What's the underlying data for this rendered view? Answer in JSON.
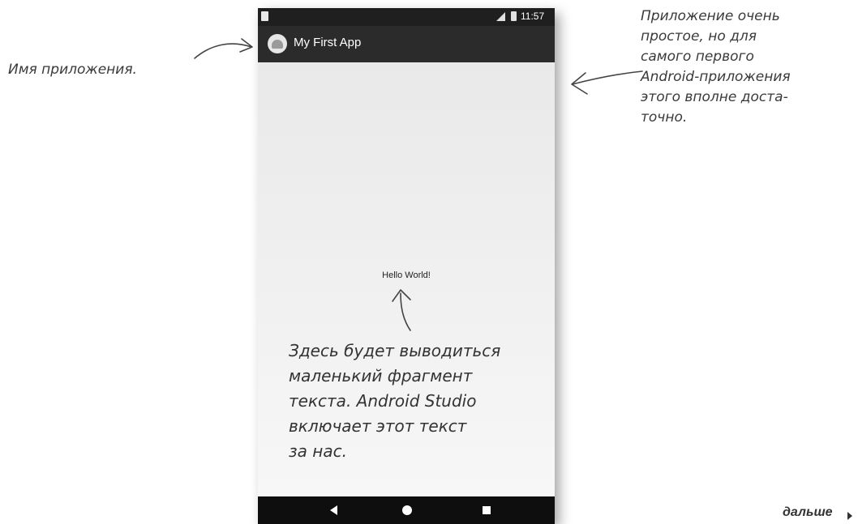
{
  "status_bar": {
    "time": "11:57"
  },
  "app": {
    "title": "My First App"
  },
  "content": {
    "text": "Hello World!"
  },
  "annotations": {
    "app_name": "Имя приложения.",
    "simple_app": "Приложение очень\nпростое, но для\nсамого первого\nAndroid-приложения\nэтого вполне доста-\nточно.",
    "text_fragment": "Здесь будет выводиться\nмаленький фрагмент\nтекста. Android Studio\nвключает этот текст\nза нас."
  },
  "footer": {
    "next_label": "дальше"
  },
  "icons": {
    "sim": "sim-card-icon",
    "signal": "signal-icon",
    "battery": "battery-icon",
    "app": "android-app-icon",
    "back": "back-icon",
    "home": "home-icon",
    "recents": "recents-icon",
    "next": "next-arrow-icon"
  }
}
